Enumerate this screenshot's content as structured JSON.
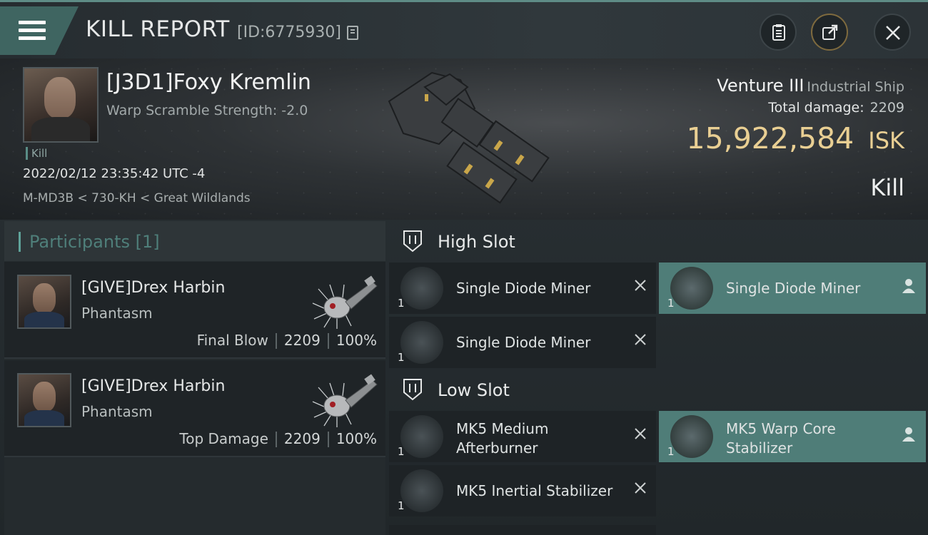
{
  "header": {
    "title": "KILL REPORT",
    "report_id": "[ID:6775930]"
  },
  "victim": {
    "name": "[J3D1]Foxy Kremlin",
    "subtitle": "Warp Scramble Strength: -2.0",
    "tag": "Kill",
    "time": "2022/02/12 23:35:42 UTC -4",
    "location": "M-MD3B < 730-KH < Great Wildlands",
    "ship_name": "Venture III",
    "ship_class": "Industrial Ship",
    "total_damage_label": "Total damage:",
    "total_damage": "2209",
    "isk_value": "15,922,584",
    "isk_unit": "ISK",
    "result": "Kill"
  },
  "participants": {
    "header": "Participants [1]",
    "cards": [
      {
        "name": "[GIVE]Drex Harbin",
        "ship": "Phantasm",
        "role": "Final Blow",
        "damage": "2209",
        "percent": "100%"
      },
      {
        "name": "[GIVE]Drex Harbin",
        "ship": "Phantasm",
        "role": "Top Damage",
        "damage": "2209",
        "percent": "100%"
      }
    ]
  },
  "fitting": {
    "high_slot": {
      "label": "High Slot",
      "modules": [
        {
          "name": "Single Diode Miner",
          "qty": "1",
          "state": "destroyed"
        },
        {
          "name": "Single Diode Miner",
          "qty": "1",
          "state": "dropped"
        },
        {
          "name": "Single Diode Miner",
          "qty": "1",
          "state": "destroyed"
        }
      ]
    },
    "low_slot": {
      "label": "Low Slot",
      "modules": [
        {
          "name": "MK5 Medium Afterburner",
          "qty": "1",
          "state": "destroyed"
        },
        {
          "name": "MK5 Warp Core Stabilizer",
          "qty": "1",
          "state": "dropped"
        },
        {
          "name": "MK5 Inertial Stabilizer",
          "qty": "1",
          "state": "destroyed"
        }
      ]
    }
  },
  "colors": {
    "accent": "#4f7d78",
    "isk": "#e9cf93",
    "header_stripe": "#5e8c86"
  },
  "icons": [
    "menu-icon",
    "copy-icon",
    "clipboard-icon",
    "share-icon",
    "close-icon",
    "slot-icon",
    "remove-icon",
    "person-icon"
  ]
}
